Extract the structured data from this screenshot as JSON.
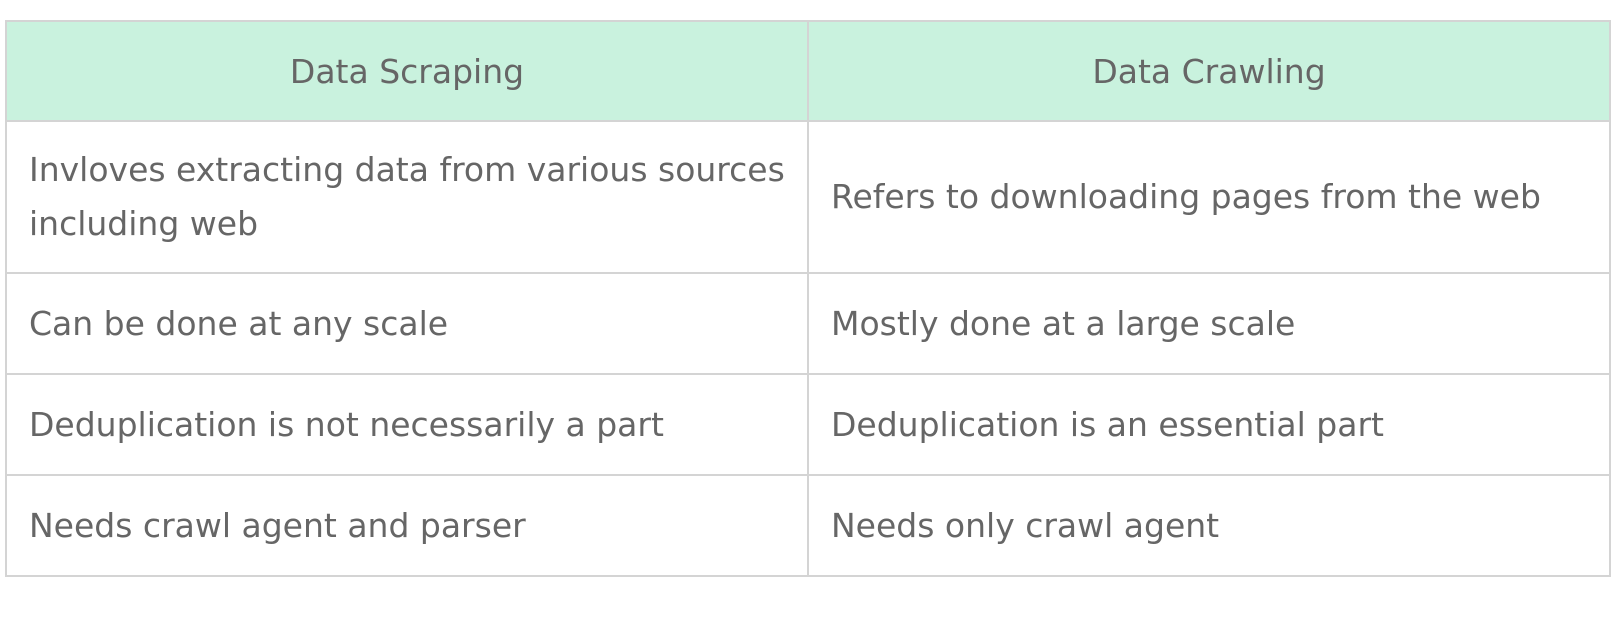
{
  "table": {
    "headers": [
      "Data Scraping",
      "Data Crawling"
    ],
    "rows": [
      [
        "Invloves extracting data from various sources including web",
        "Refers to downloading pages from the web"
      ],
      [
        "Can be done at any scale",
        "Mostly done at a large scale"
      ],
      [
        "Deduplication is not necessarily a part",
        "Deduplication is an essential part"
      ],
      [
        "Needs crawl agent and parser",
        "Needs only crawl agent"
      ]
    ],
    "header_bg": "#c9f2de",
    "border_color": "#d4d4d4",
    "text_color": "#666666"
  }
}
